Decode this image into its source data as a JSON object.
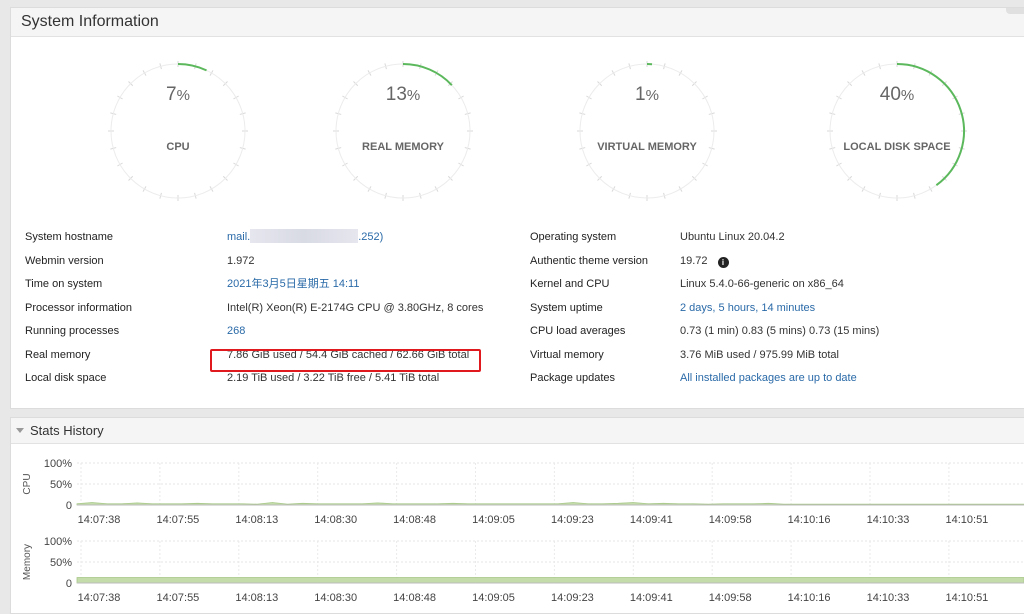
{
  "sysinfo": {
    "title": "System Information",
    "gauges": [
      {
        "label": "CPU",
        "value": "7",
        "unit": "%",
        "fraction": 0.07
      },
      {
        "label": "REAL MEMORY",
        "value": "13",
        "unit": "%",
        "fraction": 0.13
      },
      {
        "label": "VIRTUAL MEMORY",
        "value": "1",
        "unit": "%",
        "fraction": 0.01
      },
      {
        "label": "LOCAL DISK SPACE",
        "value": "40",
        "unit": "%",
        "fraction": 0.4
      }
    ],
    "left": {
      "hostname": {
        "label": "System hostname",
        "prefix": "mail.",
        "suffix": ".252)"
      },
      "webmin": {
        "label": "Webmin version",
        "value": "1.972"
      },
      "time": {
        "label": "Time on system",
        "value": "2021年3月5日星期五 14:11"
      },
      "processor": {
        "label": "Processor information",
        "value": "Intel(R) Xeon(R) E-2174G CPU @ 3.80GHz, 8 cores"
      },
      "processes": {
        "label": "Running processes",
        "value": "268"
      },
      "realmem": {
        "label": "Real memory",
        "value": "7.86 GiB used / 54.4 GiB cached / 62.66 GiB total"
      },
      "disk": {
        "label": "Local disk space",
        "value": "2.19 TiB used / 3.22 TiB free / 5.41 TiB total"
      }
    },
    "right": {
      "os": {
        "label": "Operating system",
        "value": "Ubuntu Linux 20.04.2"
      },
      "theme": {
        "label": "Authentic theme version",
        "value": "19.72",
        "icon": "info-icon"
      },
      "kernel": {
        "label": "Kernel and CPU",
        "value": "Linux 5.4.0-66-generic on x86_64"
      },
      "uptime": {
        "label": "System uptime",
        "value": "2 days, 5 hours, 14 minutes"
      },
      "load": {
        "label": "CPU load averages",
        "value": "0.73 (1 min) 0.83 (5 mins) 0.73 (15 mins)"
      },
      "vmem": {
        "label": "Virtual memory",
        "value": "3.76 MiB used / 975.99 MiB total"
      },
      "updates": {
        "label": "Package updates",
        "value": "All installed packages are up to date"
      }
    }
  },
  "stats": {
    "title": "Stats History",
    "chart_data": [
      {
        "type": "area",
        "ylabel": "CPU",
        "yticks": [
          "100%",
          "50%",
          "0"
        ],
        "ylim": [
          0,
          100
        ],
        "x": [
          "14:07:38",
          "14:07:55",
          "14:08:13",
          "14:08:30",
          "14:08:48",
          "14:09:05",
          "14:09:23",
          "14:09:41",
          "14:09:58",
          "14:10:16",
          "14:10:33",
          "14:10:51"
        ],
        "values": [
          3,
          6,
          3,
          3,
          5,
          3,
          3,
          3,
          4,
          3,
          3,
          3,
          2,
          6,
          2,
          4,
          3,
          3,
          3,
          3,
          5,
          3,
          3,
          3,
          3,
          4,
          3,
          3,
          3,
          3,
          3,
          3,
          3,
          6,
          3,
          3,
          4,
          6,
          3,
          4,
          3,
          3,
          2,
          3,
          3,
          3,
          4,
          2,
          2,
          2,
          2,
          2,
          2,
          2,
          2,
          2,
          2,
          2,
          2,
          2,
          2,
          2,
          2,
          2
        ]
      },
      {
        "type": "area",
        "ylabel": "Memory",
        "yticks": [
          "100%",
          "50%",
          "0"
        ],
        "ylim": [
          0,
          100
        ],
        "x": [
          "14:07:38",
          "14:07:55",
          "14:08:13",
          "14:08:30",
          "14:08:48",
          "14:09:05",
          "14:09:23",
          "14:09:41",
          "14:09:58",
          "14:10:16",
          "14:10:33",
          "14:10:51"
        ],
        "values": [
          13,
          13,
          13,
          13,
          13,
          13,
          13,
          13,
          13,
          13,
          13,
          13,
          13,
          13,
          13,
          13
        ]
      }
    ]
  },
  "colors": {
    "accent_green": "#5cb85c",
    "link": "#2a6aa8",
    "highlight": "#e0191f"
  }
}
